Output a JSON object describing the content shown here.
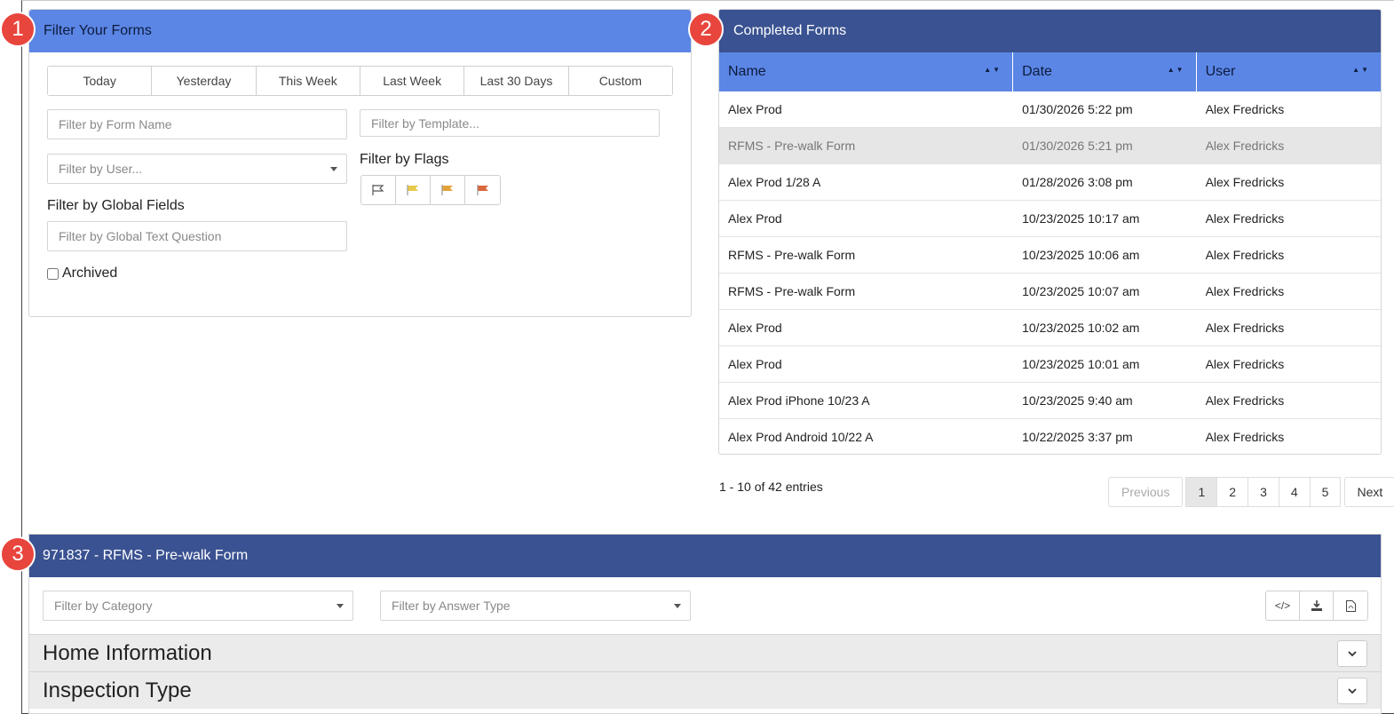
{
  "badges": [
    "1",
    "2",
    "3"
  ],
  "filter_panel": {
    "title": "Filter Your Forms",
    "ranges": [
      "Today",
      "Yesterday",
      "This Week",
      "Last Week",
      "Last 30 Days",
      "Custom"
    ],
    "form_name_placeholder": "Filter by Form Name",
    "template_placeholder": "Filter by Template...",
    "user_placeholder": "Filter by User...",
    "flags_label": "Filter by Flags",
    "flags": [
      "flag-outline-icon",
      "flag-yellow-icon",
      "flag-orange-icon",
      "flag-red-icon"
    ],
    "flag_colors": [
      "#555555",
      "#e8c94a",
      "#e3a33a",
      "#d9683b"
    ],
    "global_fields_label": "Filter by Global Fields",
    "global_text_placeholder": "Filter by Global Text Question",
    "archived_label": "Archived",
    "archived_checked": false
  },
  "completed_forms": {
    "title": "Completed Forms",
    "columns": [
      "Name",
      "Date",
      "User"
    ],
    "rows": [
      {
        "name": "Alex Prod",
        "date": "01/30/2026 5:22 pm",
        "user": "Alex Fredricks"
      },
      {
        "name": "RFMS - Pre-walk Form",
        "date": "01/30/2026 5:21 pm",
        "user": "Alex Fredricks"
      },
      {
        "name": "Alex Prod 1/28 A",
        "date": "01/28/2026 3:08 pm",
        "user": "Alex Fredricks"
      },
      {
        "name": "Alex Prod",
        "date": "10/23/2025 10:17 am",
        "user": "Alex Fredricks"
      },
      {
        "name": "RFMS - Pre-walk Form",
        "date": "10/23/2025 10:06 am",
        "user": "Alex Fredricks"
      },
      {
        "name": "RFMS - Pre-walk Form",
        "date": "10/23/2025 10:07 am",
        "user": "Alex Fredricks"
      },
      {
        "name": "Alex Prod",
        "date": "10/23/2025 10:02 am",
        "user": "Alex Fredricks"
      },
      {
        "name": "Alex Prod",
        "date": "10/23/2025 10:01 am",
        "user": "Alex Fredricks"
      },
      {
        "name": "Alex Prod iPhone 10/23 A",
        "date": "10/23/2025 9:40 am",
        "user": "Alex Fredricks"
      },
      {
        "name": "Alex Prod Android 10/22 A",
        "date": "10/22/2025 3:37 pm",
        "user": "Alex Fredricks"
      }
    ],
    "selected_row": 1,
    "entries_text": "1 - 10 of 42 entries",
    "pager": {
      "previous": "Previous",
      "pages": [
        "1",
        "2",
        "3",
        "4",
        "5"
      ],
      "current": "1",
      "next": "Next"
    }
  },
  "detail": {
    "title": "971837 - RFMS - Pre-walk Form",
    "category_placeholder": "Filter by Category",
    "answer_type_placeholder": "Filter by Answer Type",
    "tools": [
      "code-icon",
      "download-icon",
      "pdf-icon"
    ],
    "sections": [
      "Home Information",
      "Inspection Type"
    ]
  },
  "colors": {
    "light_header": "#5b86e5",
    "dark_header": "#3a5291",
    "badge": "#e8453c"
  }
}
